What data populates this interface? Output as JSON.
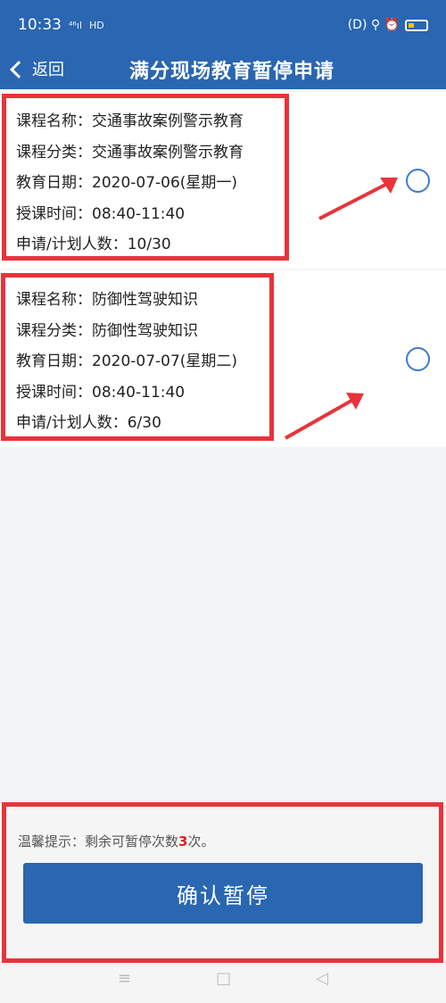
{
  "status": {
    "time": "10:33",
    "network": "HD",
    "icons": "(D) ⚲ ⏰"
  },
  "nav": {
    "back_label": "返回",
    "title": "满分现场教育暂停申请"
  },
  "courses": [
    {
      "name": "课程名称：交通事故案例警示教育",
      "category": "课程分类：交通事故案例警示教育",
      "date": "教育日期：2020-07-06(星期一)",
      "time": "授课时间：08:40-11:40",
      "count": "申请/计划人数：10/30"
    },
    {
      "name": "课程名称：防御性驾驶知识",
      "category": "课程分类：防御性驾驶知识",
      "date": "教育日期：2020-07-07(星期二)",
      "time": "授课时间：08:40-11:40",
      "count": "申请/计划人数：6/30"
    }
  ],
  "hint": {
    "prefix": "温馨提示：剩余可暂停次数",
    "remaining": "3",
    "suffix": "次。"
  },
  "confirm_label": "确认暂停",
  "system_nav": [
    "≡",
    "□",
    "◁"
  ],
  "colors": {
    "primary": "#2a66b1",
    "annotation": "#e8333b",
    "radio": "#3b7bd0",
    "hint_number": "#e02020"
  }
}
